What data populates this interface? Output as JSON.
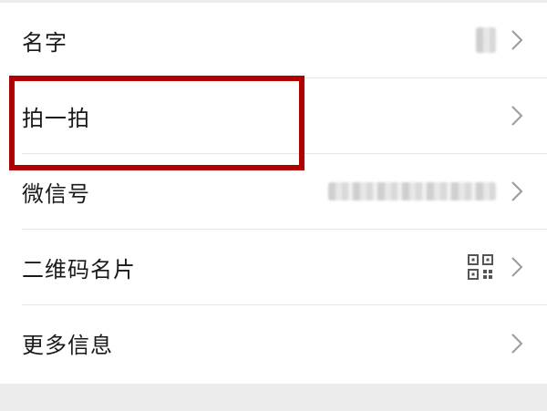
{
  "rows": [
    {
      "label": "名字",
      "key": "name"
    },
    {
      "label": "拍一拍",
      "key": "pat"
    },
    {
      "label": "微信号",
      "key": "wechat-id"
    },
    {
      "label": "二维码名片",
      "key": "qr-card"
    },
    {
      "label": "更多信息",
      "key": "more-info"
    }
  ],
  "icons": {
    "chevron": "chevron-right-icon",
    "qr": "qr-code-icon"
  },
  "colors": {
    "highlight": "#b00000",
    "text": "#1a1a1a",
    "chevron": "#9a9a9a",
    "band": "#ececec"
  }
}
